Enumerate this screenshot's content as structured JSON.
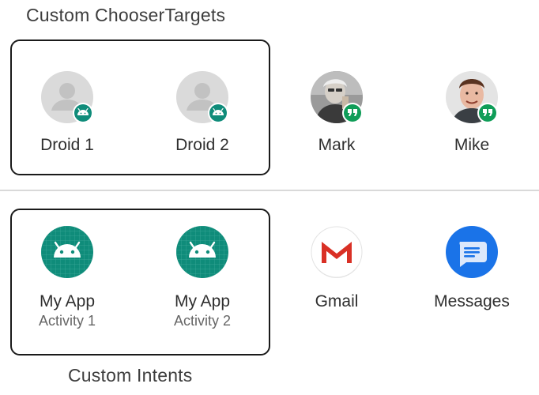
{
  "sections": {
    "chooser_targets_title": "Custom ChooserTargets",
    "custom_intents_title": "Custom Intents"
  },
  "chooser_targets": [
    {
      "label": "Droid 1",
      "avatar": "default-person-avatar",
      "badge": "android-badge-icon"
    },
    {
      "label": "Droid 2",
      "avatar": "default-person-avatar",
      "badge": "android-badge-icon"
    },
    {
      "label": "Mark",
      "avatar": "photo-avatar-mark",
      "badge": "hangouts-badge-icon"
    },
    {
      "label": "Mike",
      "avatar": "photo-avatar-mike",
      "badge": "hangouts-badge-icon"
    }
  ],
  "app_targets": [
    {
      "label": "My App",
      "sublabel": "Activity 1",
      "icon": "android-app-icon"
    },
    {
      "label": "My App",
      "sublabel": "Activity 2",
      "icon": "android-app-icon"
    },
    {
      "label": "Gmail",
      "sublabel": "",
      "icon": "gmail-icon"
    },
    {
      "label": "Messages",
      "sublabel": "",
      "icon": "messages-icon"
    }
  ],
  "colors": {
    "android_teal": "#0f8c7a",
    "hangouts_green": "#0f9d58",
    "messages_blue": "#1a73e8",
    "gmail_red": "#d93025",
    "avatar_gray": "#dadada"
  }
}
